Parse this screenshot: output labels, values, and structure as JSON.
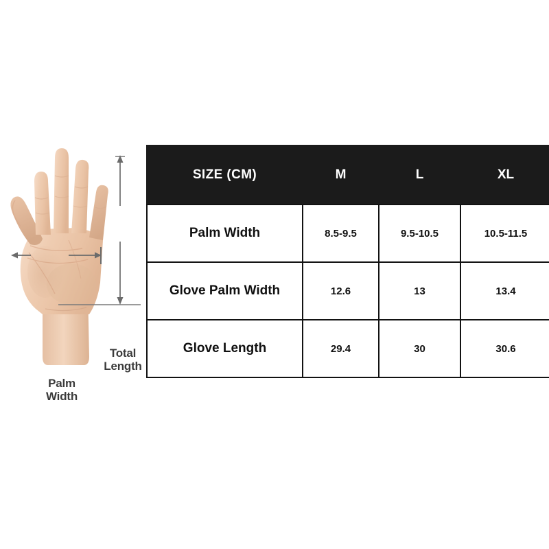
{
  "diagram": {
    "name": "hand-measurement-diagram",
    "palm_width_label": "Palm\nWidth",
    "total_length_label": "Total\nLength",
    "skin_color": "#efc9ad",
    "arrow_color": "#6b6b6b",
    "label_color": "#3b3b3b"
  },
  "table": {
    "header": {
      "label": "SIZE (CM)",
      "sizes": [
        "M",
        "L",
        "XL"
      ]
    },
    "header_bg": "#1b1b1b",
    "header_fg": "#ffffff",
    "border_color": "#121212",
    "rows": [
      {
        "label": "Palm Width",
        "values": [
          "8.5-9.5",
          "9.5-10.5",
          "10.5-11.5"
        ]
      },
      {
        "label": "Glove Palm Width",
        "values": [
          "12.6",
          "13",
          "13.4"
        ]
      },
      {
        "label": "Glove Length",
        "values": [
          "29.4",
          "30",
          "30.6"
        ]
      }
    ]
  }
}
